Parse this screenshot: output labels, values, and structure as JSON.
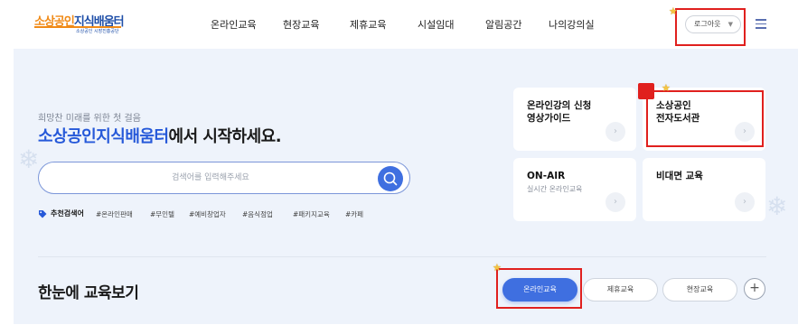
{
  "header": {
    "logo_main_orange": "소상공인",
    "logo_main_blue": "지식배움터",
    "logo_sub": "소상공인 시장진흥공단",
    "nav": [
      "온라인교육",
      "현장교육",
      "제휴교육",
      "시설임대",
      "알림공간",
      "나의강의실"
    ],
    "login_label": "로그아웃",
    "menu_icon": "hamburger-menu-icon"
  },
  "hero": {
    "tagline": "희망찬 미래를 위한 첫 걸음",
    "headline_accent": "소상공인지식배움터",
    "headline_rest": "에서 시작하세요.",
    "search_placeholder": "검색어를 입력해주세요",
    "search_value": "",
    "search_icon": "search-icon",
    "recommend_label": "추천검색어",
    "recommend_keywords": [
      "#온라인판매",
      "#무인텔",
      "#예비창업자",
      "#음식점업",
      "#패키지교육",
      "#카페"
    ]
  },
  "cards": [
    {
      "title_line1": "온라인강의 신청",
      "title_line2": "영상가이드",
      "sub": ""
    },
    {
      "title_line1": "소상공인",
      "title_line2": "전자도서관",
      "sub": ""
    },
    {
      "title_line1": "ON-AIR",
      "title_line2": "",
      "sub": "실시간 온라인교육"
    },
    {
      "title_line1": "비대면 교육",
      "title_line2": "",
      "sub": ""
    }
  ],
  "section": {
    "title": "한눈에 교육보기",
    "filters": [
      "온라인교육",
      "제휴교육",
      "현장교육"
    ],
    "plus_label": "+"
  },
  "colors": {
    "brand_orange": "#f08a17",
    "brand_blue": "#2659d9",
    "hero_bg": "#eef3fb",
    "active_pill": "#3f6fe0",
    "annotation_red": "#e0201e"
  }
}
